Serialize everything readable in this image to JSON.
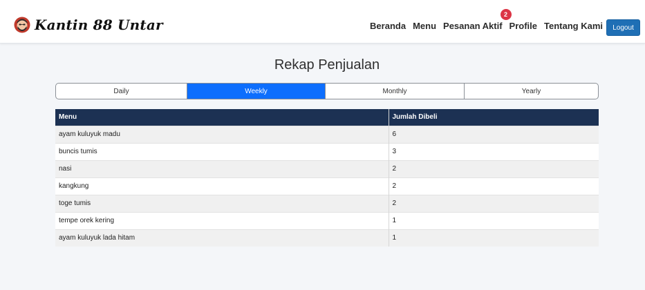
{
  "brand": {
    "name": "Kantin 88 Untar"
  },
  "nav": {
    "items": [
      "Beranda",
      "Menu",
      "Pesanan Aktif",
      "Profile",
      "Tentang Kami"
    ],
    "active_orders_badge": "2",
    "logout_label": "Logout"
  },
  "page": {
    "title": "Rekap Penjualan"
  },
  "tabs": {
    "items": [
      "Daily",
      "Weekly",
      "Monthly",
      "Yearly"
    ],
    "active": "Weekly"
  },
  "table": {
    "headers": [
      "Menu",
      "Jumlah Dibeli"
    ],
    "rows": [
      [
        "ayam kuluyuk madu",
        "6"
      ],
      [
        "buncis tumis",
        "3"
      ],
      [
        "nasi",
        "2"
      ],
      [
        "kangkung",
        "2"
      ],
      [
        "toge tumis",
        "2"
      ],
      [
        "tempe orek kering",
        "1"
      ],
      [
        "ayam kuluyuk lada hitam",
        "1"
      ]
    ]
  },
  "colors": {
    "active_tab": "#0d6efd",
    "table_header": "#1c3153",
    "logout_button": "#1f6fb5",
    "badge": "#dc3545"
  }
}
